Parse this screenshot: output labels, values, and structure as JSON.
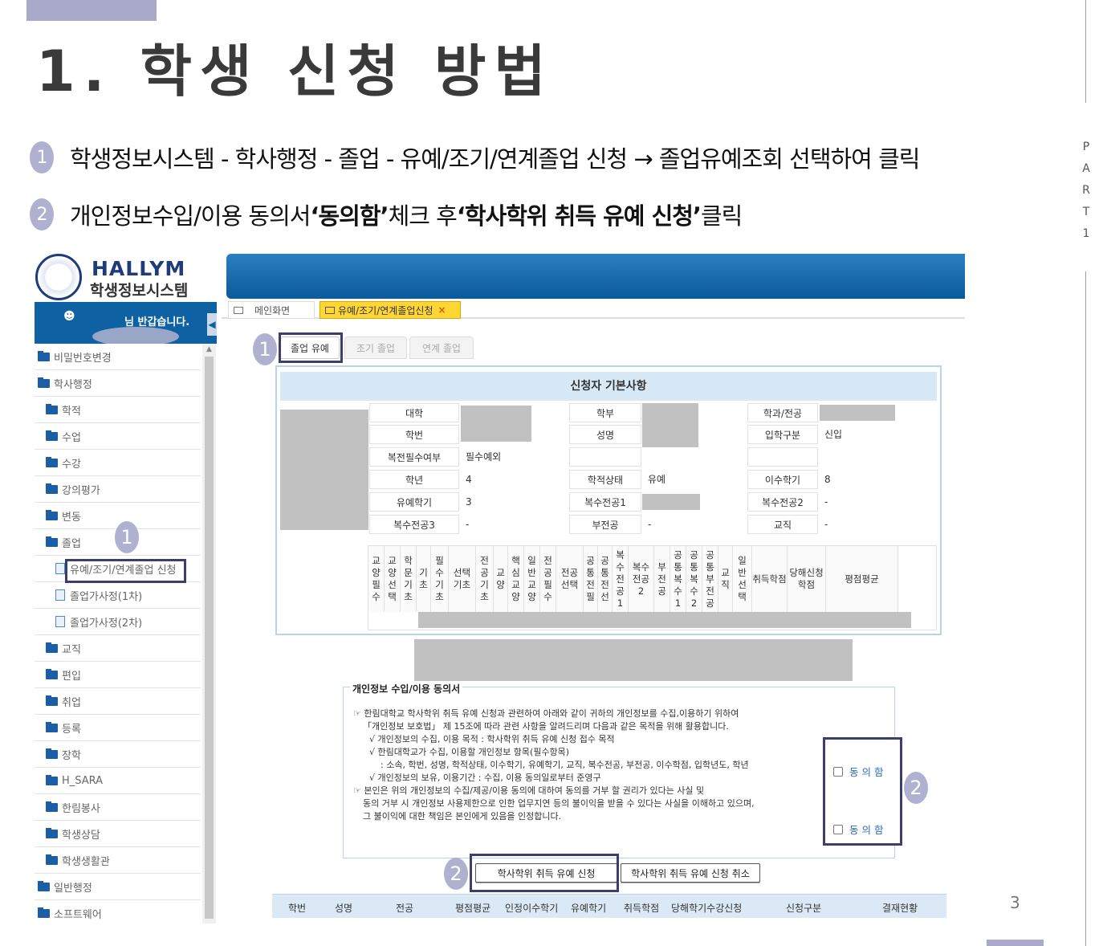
{
  "slide": {
    "title": "1. 학생 신청 방법",
    "part_label": "P A R T 1",
    "page_number": "3"
  },
  "steps": [
    {
      "num": "1",
      "text": "학생정보시스템 - 학사행정 - 졸업 - 유예/조기/연계졸업 신청 → 졸업유예조회 선택하여 클릭"
    },
    {
      "num": "2",
      "pre": "개인정보수입/이용 동의서 ",
      "b1": "‘동의함’",
      "mid": " 체크 후 ",
      "b2": "‘학사학위 취득 유예 신청’",
      "post": " 클릭"
    }
  ],
  "app": {
    "logo_en": "HALLYM",
    "logo_kr": "학생정보시스템",
    "welcome": "님 반갑습니다.",
    "user_icon": "user-icon",
    "collapse_icon": "chevron-left-icon",
    "tabs": {
      "main": "메인화면",
      "active": "유예/조기/연계졸업신청",
      "close": "×"
    },
    "subtabs": [
      "졸업 유예",
      "조기 졸업",
      "연계 졸업"
    ]
  },
  "menu": [
    {
      "label": "비밀번호변경",
      "type": "folder",
      "indent": 0
    },
    {
      "label": "학사행정",
      "type": "folder-open",
      "indent": 0
    },
    {
      "label": "학적",
      "type": "folder",
      "indent": 1
    },
    {
      "label": "수업",
      "type": "folder",
      "indent": 1
    },
    {
      "label": "수강",
      "type": "folder",
      "indent": 1
    },
    {
      "label": "강의평가",
      "type": "folder",
      "indent": 1
    },
    {
      "label": "변동",
      "type": "folder",
      "indent": 1
    },
    {
      "label": "졸업",
      "type": "folder-open",
      "indent": 1
    },
    {
      "label": "유예/조기/연계졸업 신청",
      "type": "doc",
      "indent": 2
    },
    {
      "label": "졸업가사정(1차)",
      "type": "doc",
      "indent": 2
    },
    {
      "label": "졸업가사정(2차)",
      "type": "doc",
      "indent": 2
    },
    {
      "label": "교직",
      "type": "folder",
      "indent": 1
    },
    {
      "label": "편입",
      "type": "folder",
      "indent": 1
    },
    {
      "label": "취업",
      "type": "folder",
      "indent": 1
    },
    {
      "label": "등록",
      "type": "folder",
      "indent": 1
    },
    {
      "label": "장학",
      "type": "folder",
      "indent": 1
    },
    {
      "label": "H_SARA",
      "type": "folder",
      "indent": 1
    },
    {
      "label": "한림봉사",
      "type": "folder",
      "indent": 1
    },
    {
      "label": "학생상담",
      "type": "folder",
      "indent": 1
    },
    {
      "label": "학생생활관",
      "type": "folder",
      "indent": 1
    },
    {
      "label": "일반행정",
      "type": "folder",
      "indent": 0
    },
    {
      "label": "소프트웨어",
      "type": "folder",
      "indent": 0
    }
  ],
  "info": {
    "header": "신청자 기본사항",
    "fields": {
      "college": "대학",
      "dept": "학부",
      "major": "학과/전공",
      "student_no": "학번",
      "name": "성명",
      "admission": "입학구분",
      "admission_val": "신입",
      "double_req": "복전필수여부",
      "double_req_val": "필수예외",
      "year": "학년",
      "year_val": "4",
      "status": "학적상태",
      "status_val": "유예",
      "semesters": "이수학기",
      "semesters_val": "8",
      "defer": "유예학기",
      "defer_val": "3",
      "double1": "복수전공1",
      "double2": "복수전공2",
      "double2_val": "-",
      "double3": "복수전공3",
      "double3_val": "-",
      "minor": "부전공",
      "minor_val": "-",
      "teaching": "교직",
      "teaching_val": "-"
    },
    "grid_headers": [
      "교양필수",
      "교양선택",
      "학문기초",
      "기초",
      "필수기초",
      "선택기초",
      "전공기초",
      "교양",
      "핵심교양",
      "일반교양",
      "전공필수",
      "전공선택",
      "공통전필",
      "공통전선",
      "복수전공1",
      "복수전공2",
      "부전공",
      "공통복수1",
      "공통복수2",
      "공통부전공",
      "교직",
      "일반선택",
      "취득학점",
      "당해신청학점",
      "평점평균"
    ]
  },
  "consent": {
    "legend": "개인정보 수입/이용 동의서",
    "lines": [
      "☞ 한림대학교 학사학위 취득 유예 신청과 관련하여 아래와 같이 귀하의 개인정보를 수집,이용하기 위하여",
      "「개인정보 보호법」 제 15조에 따라 관련 사항을 알려드리며 다음과 같은 목적을 위해 활용합니다.",
      "√ 개인정보의 수집, 이용 목적 : 학사학위 취득 유예 신청 접수 목적",
      "√ 한림대학교가 수집, 이용할 개인정보 항목(필수항목)",
      ": 소속, 학번, 성명, 학적상태, 이수학기, 유예학기, 교직, 복수전공, 부전공, 이수학점, 입학년도, 학년",
      "√ 개인정보의 보유, 이용기간 : 수집, 이용 동의일로부터 준영구",
      "☞ 본인은 위의 개인정보의 수집/제공/이용 동의에 대하여 동의를 거부 할 권리가 있다는 사실 및",
      "동의 거부 시 개인정보 사용제한으로 인한 업무지연 등의 불이익을 받을 수 있다는 사실을 이해하고 있으며,",
      "그 불이익에 대한 책임은 본인에게 있음을 인정합니다."
    ],
    "agree1": "동의함",
    "agree2": "동의함"
  },
  "buttons": {
    "apply": "학사학위 취득 유예 신청",
    "cancel": "학사학위 취득 유예 신청 취소"
  },
  "result_headers": [
    "학번",
    "성명",
    "전공",
    "평점평균",
    "인정이수학기",
    "유예학기",
    "취득학점",
    "당해학기수강신청",
    "신청구분",
    "결재현황"
  ],
  "callouts": {
    "a": "1",
    "b": "1",
    "c": "2",
    "d": "2"
  }
}
